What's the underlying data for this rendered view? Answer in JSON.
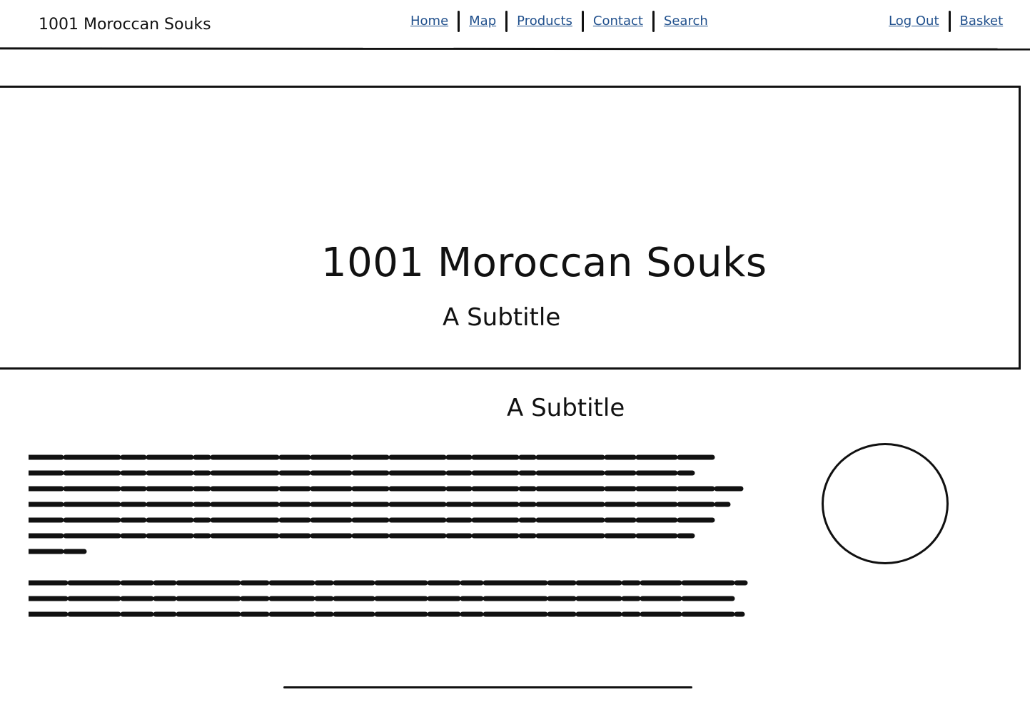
{
  "header": {
    "brand": "1001 Moroccan Souks",
    "nav": [
      "Home",
      "Map",
      "Products",
      "Contact",
      "Search"
    ],
    "account": [
      "Log Out",
      "Basket"
    ]
  },
  "hero": {
    "title": "1001 Moroccan Souks",
    "subtitle": "A Subtitle"
  },
  "section": {
    "subtitle": "A Subtitle"
  }
}
